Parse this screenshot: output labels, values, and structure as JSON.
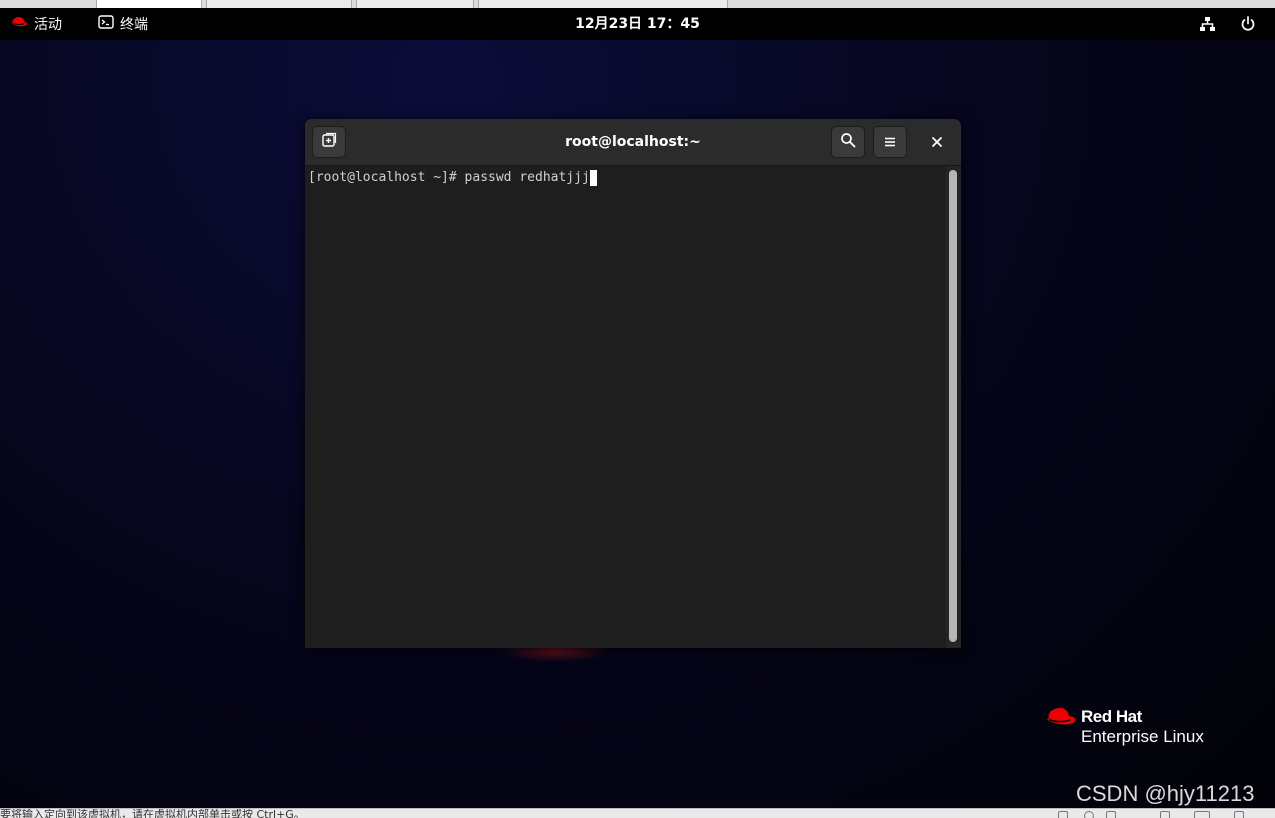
{
  "top_bar": {
    "activities_label": "活动",
    "app_label": "终端",
    "clock": "12月23日 17：45"
  },
  "terminal": {
    "title": "root@localhost:~",
    "prompt": "[root@localhost ~]# ",
    "command": "passwd redhatjjj"
  },
  "brand": {
    "name": "Red Hat",
    "product": "Enterprise Linux"
  },
  "watermark": "CSDN @hjy11213",
  "host_status": {
    "text": "要将输入定向到该虚拟机，请在虚拟机内部单击或按 Ctrl+G。"
  },
  "icons": {
    "activities": "redhat-fedora-icon",
    "app": "terminal-icon",
    "network": "network-wired-icon",
    "power": "power-icon",
    "new_tab": "new-tab-icon",
    "search": "search-icon",
    "menu": "hamburger-menu-icon",
    "close": "close-icon"
  },
  "colors": {
    "redhat_red": "#ee0000",
    "terminal_bg": "#1e1e1e",
    "header_bg": "#2b2b2b",
    "text": "#d0d0d0"
  }
}
